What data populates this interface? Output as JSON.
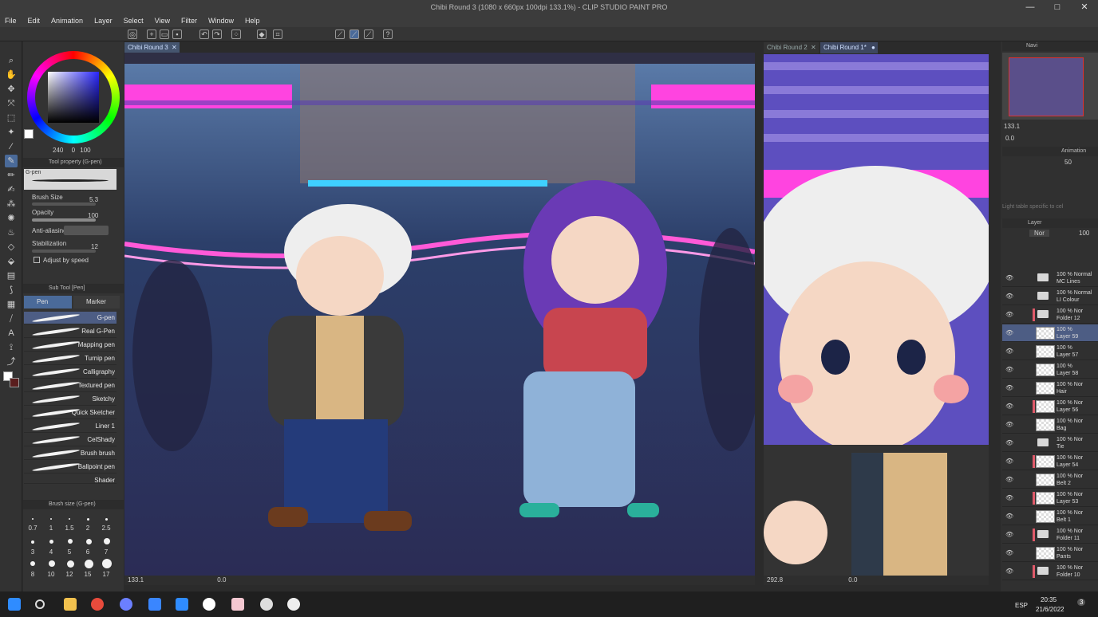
{
  "window": {
    "title": "Chibi Round 3 (1080 x 660px 100dpi 133.1%)  - CLIP STUDIO PAINT PRO",
    "minimize": "—",
    "maximize": "□",
    "close": "✕"
  },
  "menu": [
    "File",
    "Edit",
    "Animation",
    "Layer",
    "Select",
    "View",
    "Filter",
    "Window",
    "Help"
  ],
  "colors": {
    "main": "#ffffff",
    "sub": "#5a1e1e",
    "h": "240",
    "s": "0",
    "v": "100"
  },
  "tool_property": {
    "header": "Tool property (G-pen)",
    "brush_name": "G-pen",
    "brush_size_label": "Brush Size",
    "brush_size_value": "5.3",
    "opacity_label": "Opacity",
    "opacity_value": "100",
    "antialiasing_label": "Anti-aliasing",
    "stabilization_label": "Stabilization",
    "stabilization_value": "12",
    "adjust_by_speed_label": "Adjust by speed"
  },
  "sub_tool": {
    "header": "Sub Tool [Pen]",
    "tabs": [
      "Pen",
      "Marker"
    ],
    "brushes": [
      "G-pen",
      "Real G-Pen",
      "Mapping pen",
      "Turnip pen",
      "Calligraphy",
      "Textured pen",
      "Sketchy",
      "Quick Sketcher",
      "Liner 1",
      "CelShady",
      "Brush brush",
      "Ballpoint pen",
      "Shader"
    ]
  },
  "brush_size_panel": {
    "header": "Brush size (G-pen)",
    "sizes": [
      "0.7",
      "1",
      "1.5",
      "2",
      "2.5",
      "3",
      "4",
      "5",
      "6",
      "7",
      "8",
      "10",
      "12",
      "15",
      "17"
    ]
  },
  "canvas_main": {
    "tab": "Chibi Round 3",
    "zoom": "133.1",
    "angle": "0.0"
  },
  "canvas_side": {
    "tabs": [
      "Chibi Round 2",
      "Chibi Round 1*"
    ],
    "zoom": "292.8",
    "angle": "0.0"
  },
  "navigator": {
    "tab": "Navi",
    "zoom": "133.1",
    "angle": "0.0"
  },
  "animation_panel": {
    "tab": "Animation",
    "opacity": "50",
    "light_table_note": "Light table specific to cel"
  },
  "layer_panel": {
    "tab": "Layer",
    "blend_mode": "Nor",
    "opacity": "100",
    "layers": [
      {
        "pct": "100 % Normal",
        "name": "MC Lines",
        "type": "folder",
        "red": false,
        "selected": false
      },
      {
        "pct": "100 % Normal",
        "name": "LI Colour",
        "type": "folder",
        "red": false,
        "selected": false
      },
      {
        "pct": "100 % Nor",
        "name": "Folder 12",
        "type": "folder",
        "red": true,
        "selected": false
      },
      {
        "pct": "100 %",
        "name": "Layer 59",
        "type": "layer",
        "red": false,
        "selected": true
      },
      {
        "pct": "100 %",
        "name": "Layer 57",
        "type": "layer",
        "red": false,
        "selected": false
      },
      {
        "pct": "100 %",
        "name": "Layer 58",
        "type": "layer",
        "red": false,
        "selected": false
      },
      {
        "pct": "100 % Nor",
        "name": "Hair",
        "type": "layer",
        "red": false,
        "selected": false
      },
      {
        "pct": "100 % Nor",
        "name": "Layer 56",
        "type": "layer",
        "red": true,
        "selected": false
      },
      {
        "pct": "100 % Nor",
        "name": "Bag",
        "type": "layer",
        "red": false,
        "selected": false
      },
      {
        "pct": "100 % Nor",
        "name": "Tie",
        "type": "folder",
        "red": false,
        "selected": false
      },
      {
        "pct": "100 % Nor",
        "name": "Layer 54",
        "type": "layer",
        "red": true,
        "selected": false
      },
      {
        "pct": "100 % Nor",
        "name": "Belt 2",
        "type": "layer",
        "red": false,
        "selected": false
      },
      {
        "pct": "100 % Nor",
        "name": "Layer 53",
        "type": "layer",
        "red": true,
        "selected": false
      },
      {
        "pct": "100 % Nor",
        "name": "Belt 1",
        "type": "layer",
        "red": false,
        "selected": false
      },
      {
        "pct": "100 % Nor",
        "name": "Folder 11",
        "type": "folder",
        "red": true,
        "selected": false
      },
      {
        "pct": "100 % Nor",
        "name": "Pants",
        "type": "layer",
        "red": false,
        "selected": false
      },
      {
        "pct": "100 % Nor",
        "name": "Folder 10",
        "type": "folder",
        "red": true,
        "selected": false
      }
    ]
  },
  "taskbar": {
    "lang": "ESP",
    "time": "20:35",
    "date": "21/6/2022",
    "notifications": "3"
  }
}
